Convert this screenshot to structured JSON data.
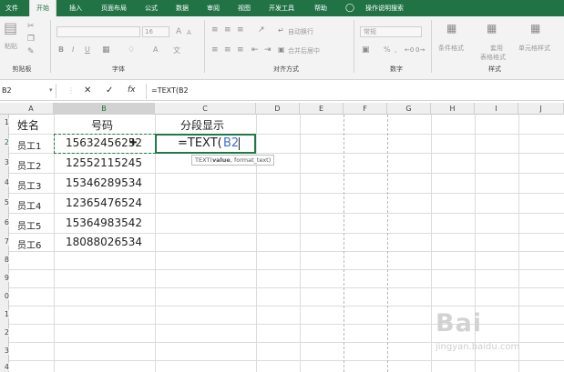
{
  "menu": {
    "tabs": [
      "文件",
      "开始",
      "插入",
      "页面布局",
      "公式",
      "数据",
      "审阅",
      "视图",
      "开发工具",
      "帮助"
    ],
    "active_tab": "开始",
    "tell_me": "操作说明搜索"
  },
  "ribbon": {
    "clipboard": {
      "paste": "粘贴",
      "group": "剪贴板"
    },
    "font": {
      "size": "16",
      "bold": "B",
      "italic": "I",
      "underline": "U",
      "grow": "A",
      "shrink": "A",
      "color": "A",
      "phonetic": "文",
      "group": "字体"
    },
    "alignment": {
      "wrap": "自动换行",
      "merge": "合并后居中",
      "group": "对齐方式"
    },
    "number": {
      "format": "常规",
      "percent": "%",
      "comma": ",",
      "group": "数字"
    },
    "styles": {
      "conditional": "条件格式",
      "table_line1": "套用",
      "table_line2": "表格格式",
      "cell_styles": "单元格样式",
      "group": "样式"
    }
  },
  "formula_bar": {
    "name_box": "B2",
    "cancel": "✕",
    "enter": "✓",
    "fx": "fx",
    "content": "=TEXT(B2"
  },
  "sheet": {
    "columns": [
      "A",
      "B",
      "C",
      "D",
      "E",
      "F",
      "G",
      "H",
      "I",
      "J"
    ],
    "rows": [
      "1",
      "2",
      "3",
      "4",
      "5",
      "6",
      "7",
      "8",
      "9",
      "0",
      "1",
      "2",
      "3",
      "4"
    ],
    "header_row": {
      "a": "姓名",
      "b": "号码",
      "c": "分段显示"
    },
    "data": [
      {
        "name": "员工1",
        "number": "15632456252"
      },
      {
        "name": "员工2",
        "number": "12552115245"
      },
      {
        "name": "员工3",
        "number": "15346289534"
      },
      {
        "name": "员工4",
        "number": "12365476524"
      },
      {
        "name": "员工5",
        "number": "15364983542"
      },
      {
        "name": "员工6",
        "number": "18088026534"
      }
    ],
    "editing_cell": {
      "prefix": "=TEXT(",
      "ref": "B2"
    },
    "tooltip": {
      "fn": "TEXT(",
      "arg1": "value",
      "rest": ", format_text)"
    }
  },
  "watermark": {
    "main": "Bai",
    "sub": "jingyan.baidu.com"
  },
  "colors": {
    "excel_green": "#217346",
    "selection_green": "#1f7a45",
    "ref_blue": "#3f6fcf"
  }
}
